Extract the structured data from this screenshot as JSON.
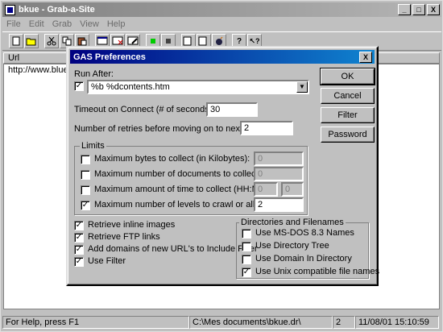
{
  "app": {
    "title": "bkue - Grab-a-Site",
    "min": "_",
    "max": "□",
    "close": "X"
  },
  "menu": [
    "File",
    "Edit",
    "Grab",
    "View",
    "Help"
  ],
  "list": {
    "header": "Url",
    "rows": [
      "http://www.blues"
    ]
  },
  "status": {
    "help": "For Help, press F1",
    "path": "C:\\Mes documents\\bkue.dr\\",
    "count": "2",
    "datetime": "11/08/01 15:10:59"
  },
  "dialog": {
    "title": "GAS Preferences",
    "close": "X",
    "run_after_label": "Run After:",
    "run_after_value": "%b %dcontents.htm",
    "run_after_checked": true,
    "timeout_label": "Timeout on Connect (# of seconds):",
    "timeout_value": "30",
    "retries_label": "Number of retries before moving on to next level:",
    "retries_value": "2",
    "limits": {
      "title": "Limits",
      "max_bytes_label": "Maximum bytes to collect (in Kilobytes):",
      "max_bytes_value": "0",
      "max_docs_label": "Maximum number of documents to collect:",
      "max_docs_value": "0",
      "max_time_label": "Maximum amount of time to collect (HH:MM):",
      "max_time_h": "0",
      "max_time_m": "0",
      "max_levels_label": "Maximum number of levels to crawl or all levels:",
      "max_levels_value": "2"
    },
    "options": {
      "inline_images": "Retrieve inline images",
      "ftp_links": "Retrieve FTP links",
      "add_domains": "Add domains of new URL's to Include Filter",
      "use_filter": "Use Filter"
    },
    "dirs": {
      "title": "Directories and Filenames",
      "msdos": "Use MS-DOS 8.3 Names",
      "dir_tree": "Use Directory Tree",
      "domain_dir": "Use Domain In Directory",
      "unix_names": "Use Unix compatible file names"
    },
    "buttons": {
      "ok": "OK",
      "cancel": "Cancel",
      "filter": "Filter",
      "password": "Password"
    },
    "check_mark": "✓"
  }
}
